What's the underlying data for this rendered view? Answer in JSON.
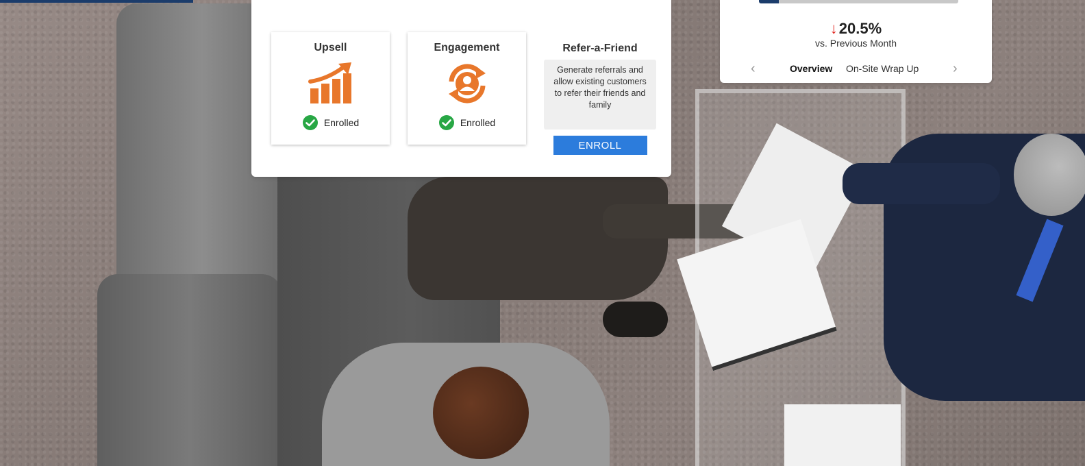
{
  "programs": {
    "tiles": [
      {
        "title": "Upsell",
        "status": "Enrolled",
        "icon": "growth-chart-icon"
      },
      {
        "title": "Engagement",
        "status": "Enrolled",
        "icon": "engagement-cycle-icon"
      }
    ],
    "refer": {
      "title": "Refer-a-Friend",
      "description": "Generate referrals and allow existing customers to refer their friends and family",
      "button_label": "ENROLL"
    }
  },
  "metric": {
    "progress_fraction": 0.1,
    "change_value": "20.5%",
    "change_direction": "down",
    "comparison_label": "vs. Previous Month",
    "tabs": [
      "Overview",
      "On-Site Wrap Up"
    ],
    "active_tab": "Overview"
  },
  "colors": {
    "accent_blue": "#2c7cdc",
    "navy": "#1b3c6b",
    "icon_orange": "#e8772b",
    "check_green": "#28a745",
    "down_red": "#e0231c"
  }
}
